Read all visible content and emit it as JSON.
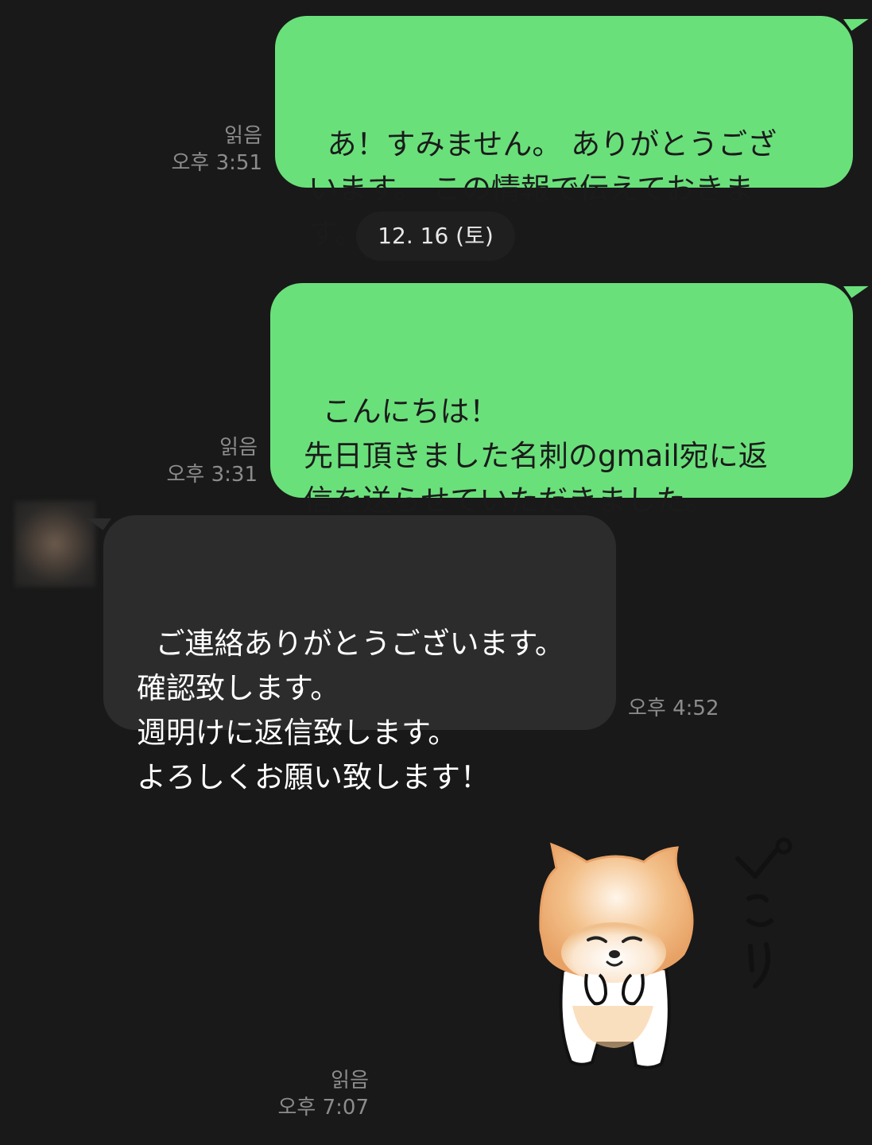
{
  "messages": [
    {
      "id": "m1",
      "direction": "sent",
      "text": "あ！すみません。 ありがとうござ\nいます。 この情報で伝えておきま\nす。",
      "read": "읽음",
      "time": "오후 3:51"
    },
    {
      "id": "m2",
      "direction": "sent",
      "text": "こんにちは！\n先日頂きました名刺のgmail宛に返\n信を送らせていただきました。\n確認お願いいたします。",
      "read": "읽음",
      "time": "오후 3:31"
    },
    {
      "id": "m3",
      "direction": "received",
      "text": "ご連絡ありがとうございます。\n確認致します。\n週明けに返信致します。\nよろしくお願い致します！",
      "time": "오후 4:52"
    },
    {
      "id": "m4",
      "direction": "sent",
      "sticker": "shiba-dog-bowing-sticker",
      "sticker_caption": "ぺこり",
      "read": "읽음",
      "time": "오후 7:07"
    }
  ],
  "date_separator": "12. 16 (토)",
  "colors": {
    "background": "#191919",
    "sent_bubble": "#6ae07b",
    "received_bubble": "#2c2c2c",
    "meta_text": "#8c8c8c"
  }
}
